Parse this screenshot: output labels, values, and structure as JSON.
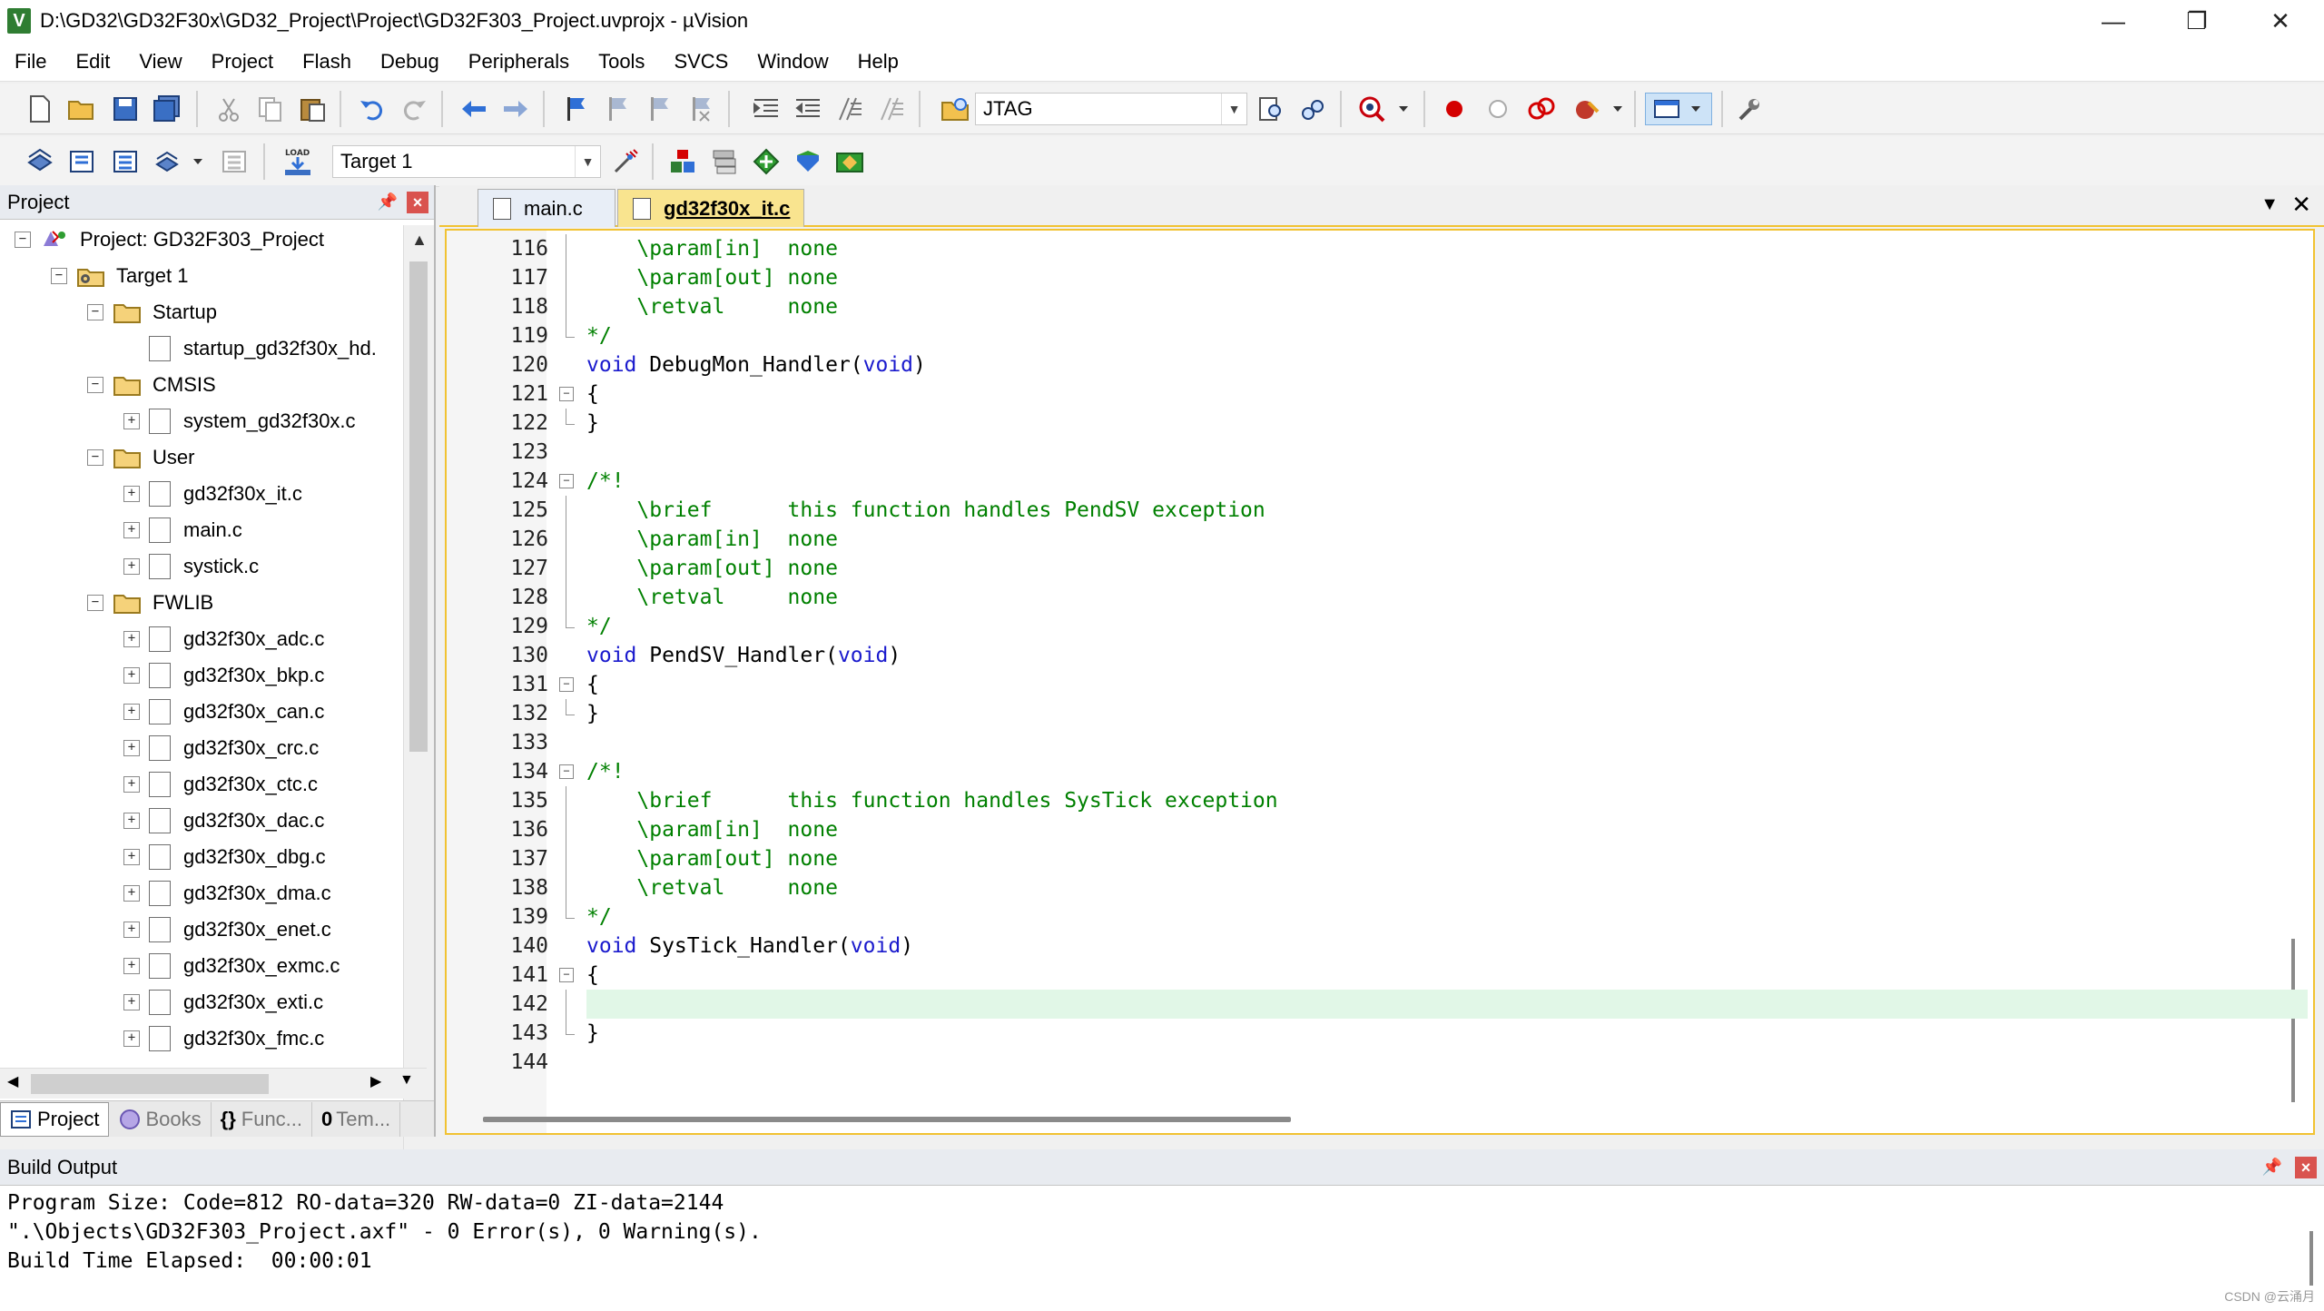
{
  "window": {
    "title": "D:\\GD32\\GD32F30x\\GD32_Project\\Project\\GD32F303_Project.uvprojx - µVision",
    "icon_letter": "V",
    "controls": [
      "—",
      "❐",
      "✕"
    ]
  },
  "menu": [
    "File",
    "Edit",
    "View",
    "Project",
    "Flash",
    "Debug",
    "Peripherals",
    "Tools",
    "SVCS",
    "Window",
    "Help"
  ],
  "toolbar1": {
    "debugger_combo": "JTAG",
    "icons": [
      "new-file-icon",
      "open-file-icon",
      "save-icon",
      "save-all-icon",
      "cut-icon",
      "copy-icon",
      "paste-icon",
      "undo-icon",
      "redo-icon",
      "nav-back-icon",
      "nav-forward-icon",
      "bookmark-icon",
      "prev-bookmark-icon",
      "next-bookmark-icon",
      "clear-bookmarks-icon",
      "indent-icon",
      "unindent-icon",
      "comment-icon",
      "uncomment-icon",
      "find-in-files-icon",
      "find-icon",
      "incremental-find-icon",
      "debug-session-icon",
      "breakpoint-icon",
      "disable-breakpoint-icon",
      "kill-breakpoints-icon",
      "window-layout-icon",
      "configure-icon"
    ]
  },
  "toolbar2": {
    "target_combo": "Target 1",
    "load_label": "LOAD",
    "icons": [
      "translate-icon",
      "build-icon",
      "rebuild-icon",
      "batch-build-icon",
      "stop-build-icon",
      "download-icon",
      "target-options-icon",
      "manage-components-icon",
      "select-packs-icon",
      "pack-installer-icon",
      "run-time-env-icon",
      "pack-icon"
    ]
  },
  "project_panel": {
    "title": "Project",
    "tree": [
      {
        "label": "Project: GD32F303_Project",
        "level": 0,
        "type": "project",
        "expander": "−"
      },
      {
        "label": "Target 1",
        "level": 1,
        "type": "target",
        "expander": "−"
      },
      {
        "label": "Startup",
        "level": 2,
        "type": "folder",
        "expander": "−"
      },
      {
        "label": "startup_gd32f30x_hd.",
        "level": 3,
        "type": "file",
        "expander": ""
      },
      {
        "label": "CMSIS",
        "level": 2,
        "type": "folder",
        "expander": "−"
      },
      {
        "label": "system_gd32f30x.c",
        "level": 3,
        "type": "file",
        "expander": "+"
      },
      {
        "label": "User",
        "level": 2,
        "type": "folder",
        "expander": "−"
      },
      {
        "label": "gd32f30x_it.c",
        "level": 3,
        "type": "file",
        "expander": "+"
      },
      {
        "label": "main.c",
        "level": 3,
        "type": "file",
        "expander": "+"
      },
      {
        "label": "systick.c",
        "level": 3,
        "type": "file",
        "expander": "+"
      },
      {
        "label": "FWLIB",
        "level": 2,
        "type": "folder",
        "expander": "−"
      },
      {
        "label": "gd32f30x_adc.c",
        "level": 3,
        "type": "file",
        "expander": "+"
      },
      {
        "label": "gd32f30x_bkp.c",
        "level": 3,
        "type": "file",
        "expander": "+"
      },
      {
        "label": "gd32f30x_can.c",
        "level": 3,
        "type": "file",
        "expander": "+"
      },
      {
        "label": "gd32f30x_crc.c",
        "level": 3,
        "type": "file",
        "expander": "+"
      },
      {
        "label": "gd32f30x_ctc.c",
        "level": 3,
        "type": "file",
        "expander": "+"
      },
      {
        "label": "gd32f30x_dac.c",
        "level": 3,
        "type": "file",
        "expander": "+"
      },
      {
        "label": "gd32f30x_dbg.c",
        "level": 3,
        "type": "file",
        "expander": "+"
      },
      {
        "label": "gd32f30x_dma.c",
        "level": 3,
        "type": "file",
        "expander": "+"
      },
      {
        "label": "gd32f30x_enet.c",
        "level": 3,
        "type": "file",
        "expander": "+"
      },
      {
        "label": "gd32f30x_exmc.c",
        "level": 3,
        "type": "file",
        "expander": "+"
      },
      {
        "label": "gd32f30x_exti.c",
        "level": 3,
        "type": "file",
        "expander": "+"
      },
      {
        "label": "gd32f30x_fmc.c",
        "level": 3,
        "type": "file",
        "expander": "+"
      }
    ],
    "tabs": [
      {
        "label": "Project",
        "icon": "project-tab-icon",
        "active": true
      },
      {
        "label": "Books",
        "icon": "books-tab-icon",
        "active": false
      },
      {
        "label": "Func...",
        "icon": "functions-tab-icon",
        "active": false
      },
      {
        "label": "Tem...",
        "icon": "templates-tab-icon",
        "active": false
      }
    ],
    "functions_glyph": "{}",
    "templates_glyph": "0"
  },
  "editor": {
    "tabs": [
      {
        "label": "main.c",
        "active": false
      },
      {
        "label": "gd32f30x_it.c",
        "active": true
      }
    ],
    "lines": [
      {
        "n": "116",
        "fold": "line",
        "parts": [
          [
            "c",
            "    \\param[in]  none"
          ]
        ]
      },
      {
        "n": "117",
        "fold": "line",
        "parts": [
          [
            "c",
            "    \\param[out] none"
          ]
        ]
      },
      {
        "n": "118",
        "fold": "line",
        "parts": [
          [
            "c",
            "    \\retval     none"
          ]
        ]
      },
      {
        "n": "119",
        "fold": "end",
        "parts": [
          [
            "c",
            "*/"
          ]
        ]
      },
      {
        "n": "120",
        "fold": "",
        "parts": [
          [
            "k",
            "void"
          ],
          [
            "p",
            " DebugMon_Handler("
          ],
          [
            "k",
            "void"
          ],
          [
            "p",
            ")"
          ]
        ]
      },
      {
        "n": "121",
        "fold": "box",
        "parts": [
          [
            "p",
            "{"
          ]
        ]
      },
      {
        "n": "122",
        "fold": "end",
        "parts": [
          [
            "p",
            "}"
          ]
        ]
      },
      {
        "n": "123",
        "fold": "",
        "parts": []
      },
      {
        "n": "124",
        "fold": "box",
        "parts": [
          [
            "c",
            "/*!"
          ]
        ]
      },
      {
        "n": "125",
        "fold": "line",
        "parts": [
          [
            "c",
            "    \\brief      this function handles PendSV exception"
          ]
        ]
      },
      {
        "n": "126",
        "fold": "line",
        "parts": [
          [
            "c",
            "    \\param[in]  none"
          ]
        ]
      },
      {
        "n": "127",
        "fold": "line",
        "parts": [
          [
            "c",
            "    \\param[out] none"
          ]
        ]
      },
      {
        "n": "128",
        "fold": "line",
        "parts": [
          [
            "c",
            "    \\retval     none"
          ]
        ]
      },
      {
        "n": "129",
        "fold": "end",
        "parts": [
          [
            "c",
            "*/"
          ]
        ]
      },
      {
        "n": "130",
        "fold": "",
        "parts": [
          [
            "k",
            "void"
          ],
          [
            "p",
            " PendSV_Handler("
          ],
          [
            "k",
            "void"
          ],
          [
            "p",
            ")"
          ]
        ]
      },
      {
        "n": "131",
        "fold": "box",
        "parts": [
          [
            "p",
            "{"
          ]
        ]
      },
      {
        "n": "132",
        "fold": "end",
        "parts": [
          [
            "p",
            "}"
          ]
        ]
      },
      {
        "n": "133",
        "fold": "",
        "parts": []
      },
      {
        "n": "134",
        "fold": "box",
        "parts": [
          [
            "c",
            "/*!"
          ]
        ]
      },
      {
        "n": "135",
        "fold": "line",
        "parts": [
          [
            "c",
            "    \\brief      this function handles SysTick exception"
          ]
        ]
      },
      {
        "n": "136",
        "fold": "line",
        "parts": [
          [
            "c",
            "    \\param[in]  none"
          ]
        ]
      },
      {
        "n": "137",
        "fold": "line",
        "parts": [
          [
            "c",
            "    \\param[out] none"
          ]
        ]
      },
      {
        "n": "138",
        "fold": "line",
        "parts": [
          [
            "c",
            "    \\retval     none"
          ]
        ]
      },
      {
        "n": "139",
        "fold": "end",
        "parts": [
          [
            "c",
            "*/"
          ]
        ]
      },
      {
        "n": "140",
        "fold": "",
        "parts": [
          [
            "k",
            "void"
          ],
          [
            "p",
            " SysTick_Handler("
          ],
          [
            "k",
            "void"
          ],
          [
            "p",
            ")"
          ]
        ]
      },
      {
        "n": "141",
        "fold": "box",
        "parts": [
          [
            "p",
            "{"
          ]
        ]
      },
      {
        "n": "142",
        "fold": "line",
        "parts": [],
        "highlight": true
      },
      {
        "n": "143",
        "fold": "end",
        "parts": [
          [
            "p",
            "}"
          ]
        ]
      },
      {
        "n": "144",
        "fold": "",
        "parts": []
      }
    ],
    "colors": {
      "comment": "#008000",
      "keyword": "#1a1acd",
      "current_line": "#e1f7e7",
      "active_tab": "#f9e48f"
    }
  },
  "build_output": {
    "title": "Build Output",
    "lines": [
      "Program Size: Code=812 RO-data=320 RW-data=0 ZI-data=2144",
      "\".\\Objects\\GD32F303_Project.axf\" - 0 Error(s), 0 Warning(s).",
      "Build Time Elapsed:  00:00:01"
    ]
  },
  "watermark": "CSDN @云涌月"
}
